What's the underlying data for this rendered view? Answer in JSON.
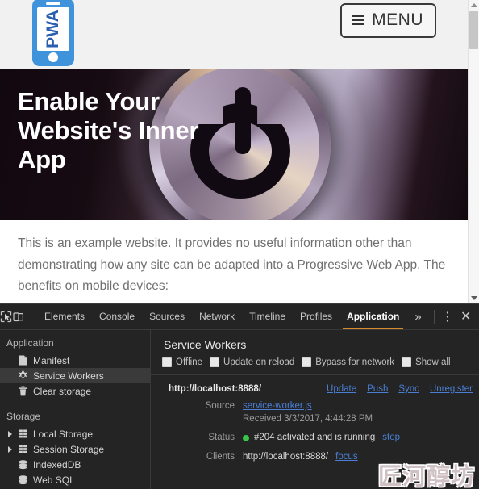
{
  "page": {
    "logo": {
      "name": "pwa-phone-logo",
      "text": "PWA"
    },
    "menu_button_label": "MENU",
    "hero": {
      "title": "Enable Your Website's Inner App"
    },
    "body_paragraph": "This is an example website. It provides no useful information other than demonstrating how any site can be adapted into a Progressive Web App. The benefits on mobile devices:"
  },
  "devtools": {
    "toolbar": {
      "inspect_icon": "inspect-element-icon",
      "device_icon": "device-toolbar-icon",
      "tabs": [
        {
          "label": "Elements",
          "active": false
        },
        {
          "label": "Console",
          "active": false
        },
        {
          "label": "Sources",
          "active": false
        },
        {
          "label": "Network",
          "active": false
        },
        {
          "label": "Timeline",
          "active": false
        },
        {
          "label": "Profiles",
          "active": false
        },
        {
          "label": "Application",
          "active": true
        }
      ],
      "more_tabs": "»",
      "menu_dots": "⋮",
      "close": "✕",
      "active_tab_underline_color": "#d98b2b"
    },
    "sidebar": {
      "sections": [
        {
          "title": "Application",
          "items": [
            {
              "label": "Manifest",
              "icon": "document-icon",
              "selected": false,
              "expandable": false
            },
            {
              "label": "Service Workers",
              "icon": "gear-icon",
              "selected": true,
              "expandable": false
            },
            {
              "label": "Clear storage",
              "icon": "trash-icon",
              "selected": false,
              "expandable": false
            }
          ]
        },
        {
          "title": "Storage",
          "items": [
            {
              "label": "Local Storage",
              "icon": "table-icon",
              "selected": false,
              "expandable": true
            },
            {
              "label": "Session Storage",
              "icon": "table-icon",
              "selected": false,
              "expandable": true
            },
            {
              "label": "IndexedDB",
              "icon": "database-icon",
              "selected": false,
              "expandable": false
            },
            {
              "label": "Web SQL",
              "icon": "database-icon",
              "selected": false,
              "expandable": false
            }
          ]
        }
      ]
    },
    "service_workers": {
      "panel_title": "Service Workers",
      "options": [
        {
          "label": "Offline",
          "checked": false
        },
        {
          "label": "Update on reload",
          "checked": false
        },
        {
          "label": "Bypass for network",
          "checked": false
        },
        {
          "label": "Show all",
          "checked": false
        }
      ],
      "registration": {
        "scope_url": "http://localhost:8888/",
        "actions": [
          "Update",
          "Push",
          "Sync",
          "Unregister"
        ],
        "rows": [
          {
            "label": "Source",
            "value": "service-worker.js",
            "value_is_link": true,
            "sub": "Received 3/3/2017, 4:44:28 PM"
          },
          {
            "label": "Status",
            "value": "#204 activated and is running",
            "status_dot_color": "#38c64a",
            "action": "stop"
          },
          {
            "label": "Clients",
            "value": "http://localhost:8888/",
            "action": "focus"
          }
        ]
      }
    }
  },
  "watermark": {
    "text": "匠河醇坊"
  }
}
